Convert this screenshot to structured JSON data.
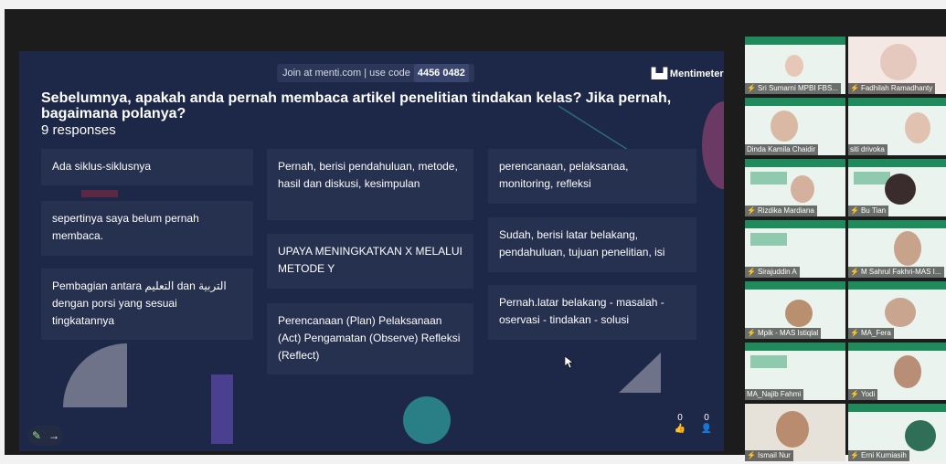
{
  "presentation": {
    "join_text": "Join at menti.com | use code",
    "code": "4456 0482",
    "brand": "Mentimeter",
    "brand_icon": "mentimeter-logo-icon",
    "question": "Sebelumnya, apakah anda pernah membaca artikel penelitian tindakan kelas? Jika pernah, bagaimana polanya?",
    "responses_count": "9 responses",
    "cards": [
      "Ada siklus-siklusnya",
      "sepertinya saya belum pernah membaca.",
      "Pembagian antara التعليم dan التربية dengan porsi yang sesuai tingkatannya",
      "Pernah, berisi pendahuluan, metode, hasil dan diskusi, kesimpulan",
      "UPAYA MENINGKATKAN X MELALUI METODE Y",
      "Perencanaan (Plan) Pelaksanaan (Act) Pengamatan (Observe) Refleksi (Reflect)",
      "perencanaan, pelaksanaa, monitoring, refleksi",
      "Sudah, berisi latar belakang, pendahuluan, tujuan penelitian, isi",
      "Pernah.latar belakang - masalah - oservasi - tindakan - solusi"
    ],
    "footer": {
      "reactions_count": "0",
      "participants_count": "0"
    },
    "colors": {
      "background": "#1d2747",
      "card": "#26304f",
      "accent": "#9fe37f"
    }
  },
  "participants": [
    "Sri Sumarni MPBI FBS...",
    "Fadhilah Ramadhanty",
    "Dinda Kamila Chaidir",
    "siti drivoka",
    "Rizdika Mardiana",
    "Bu Tian",
    "Sirajuddin A",
    "M Sahrul Fakhri-MAS I...",
    "Mpik - MAS Istiqlal",
    "MA_Fera",
    "MA_Najib Fahmi",
    "Yodi",
    "Ismail Nur",
    "Erni Kurniasih"
  ]
}
